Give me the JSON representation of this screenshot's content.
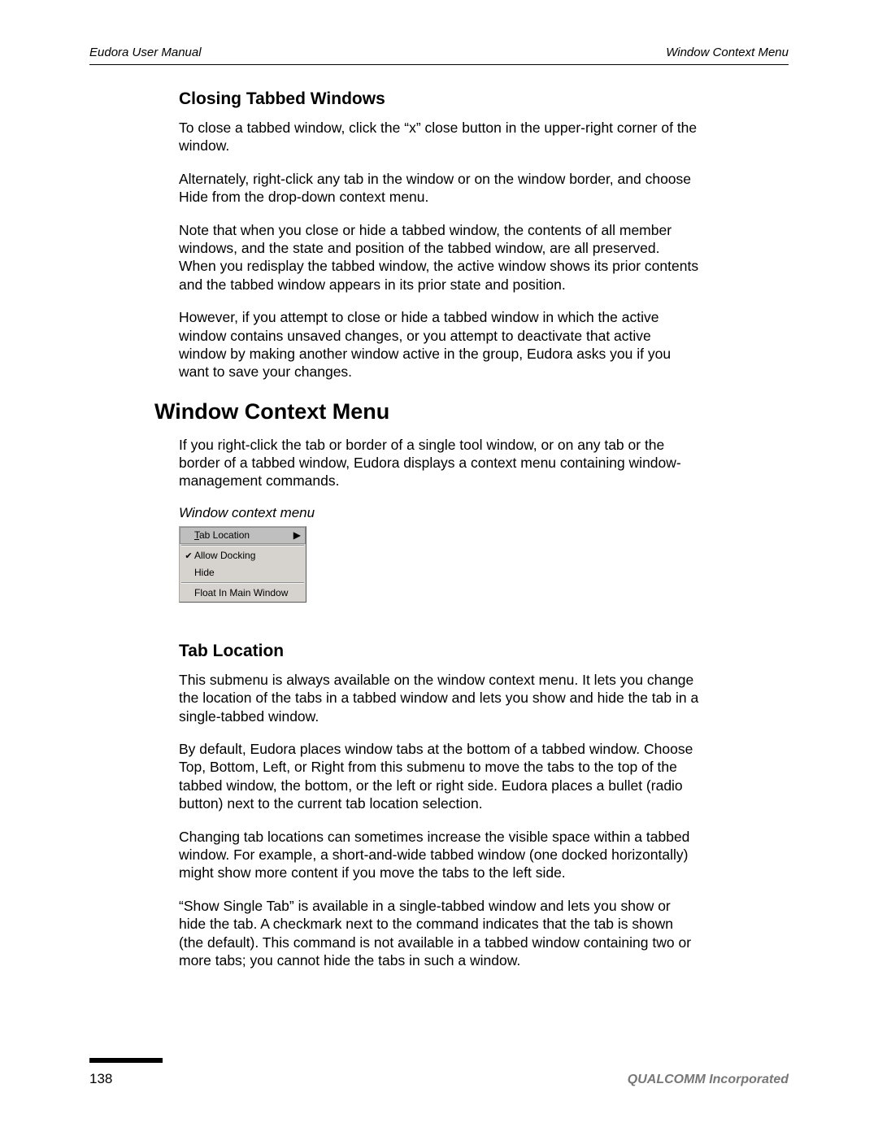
{
  "header": {
    "left": "Eudora User Manual",
    "right": "Window Context Menu"
  },
  "section1": {
    "title": "Closing Tabbed Windows",
    "p1": "To close a tabbed window, click the “x” close button in the upper-right corner of the window.",
    "p2": "Alternately, right-click any tab in the window or on the window border, and choose Hide from the drop-down context menu.",
    "p3": "Note that when you close or hide a tabbed window, the contents of all member windows, and the state and position of the tabbed window, are all preserved. When you redisplay the tabbed window, the active window shows its prior contents and the tabbed window appears in its prior state and position.",
    "p4": "However, if you attempt to close or hide a tabbed window in which the active window contains unsaved changes, or you attempt to deactivate that active window by making another window active in the group, Eudora asks you if you want to save your changes."
  },
  "heading2": "Window Context Menu",
  "p_wcm": "If you right-click the tab or border of a single tool window, or on any tab or the border of a tabbed window, Eudora displays a context menu containing window-management commands.",
  "menu_caption": "Window context menu",
  "menu": {
    "tab_location_rest": "ab Location",
    "allow_docking": "Allow Docking",
    "hide": "Hide",
    "float": "Float In Main Window",
    "tab_location_mn": "T",
    "checkmark": "✔",
    "arrow": "▶"
  },
  "section3": {
    "title": "Tab Location",
    "p1": "This submenu is always available on the window context menu. It lets you change the location of the tabs in a tabbed window and lets you show and hide the tab in a single-tabbed window.",
    "p2": "By default, Eudora places window tabs at the bottom of a tabbed window. Choose Top, Bottom, Left, or Right from this submenu to move the tabs to the top of the tabbed window, the bottom, or the left or right side. Eudora places a bullet (radio button) next to the current tab location selection.",
    "p3": "Changing tab locations can sometimes increase the visible space within a tabbed window. For example, a short-and-wide tabbed window (one docked horizontally) might show more content if you move the tabs to the left side.",
    "p4": "“Show Single Tab” is available in a single-tabbed window and lets you show or hide the tab. A checkmark next to the command indicates that the tab is shown (the default). This command is not available in a tabbed window containing two or more tabs; you cannot hide the tabs in such a window."
  },
  "footer": {
    "page": "138",
    "company": "QUALCOMM Incorporated"
  }
}
